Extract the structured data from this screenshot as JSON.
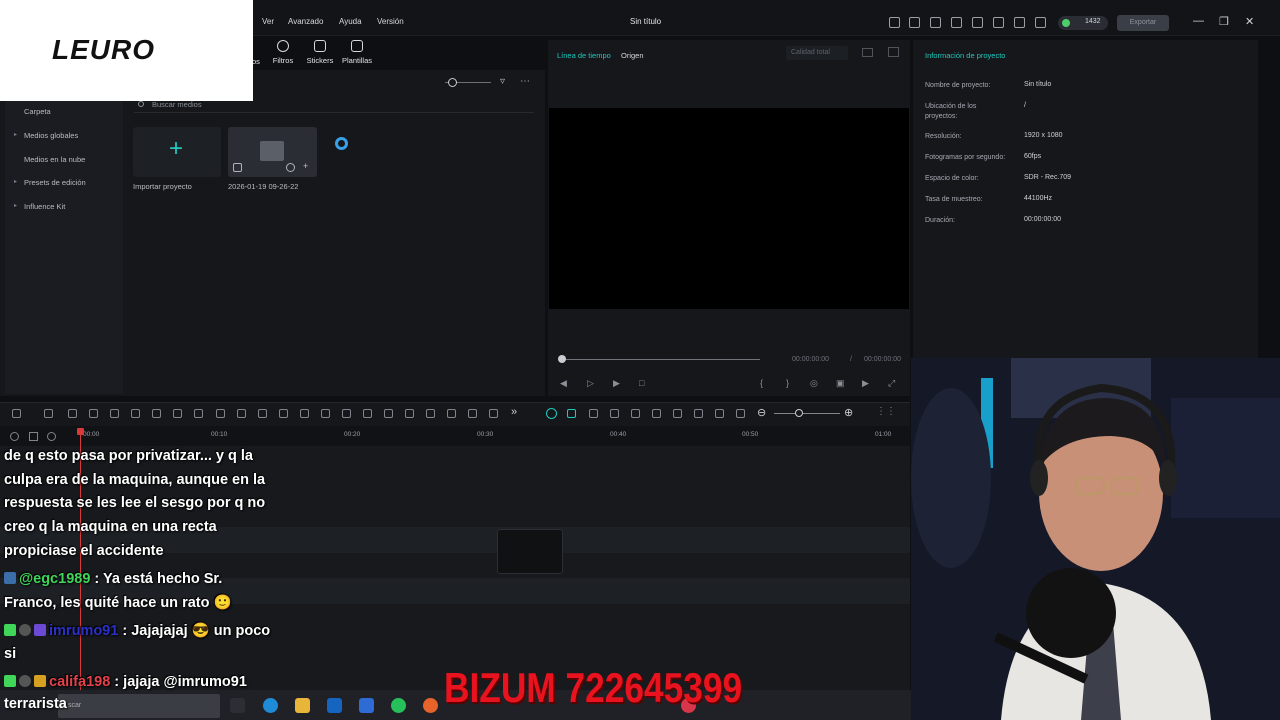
{
  "app": {
    "window_title": "Sin título",
    "menu": [
      "Ver",
      "Avanzado",
      "Ayuda",
      "Versión"
    ],
    "credits": "1432",
    "export_label": "Exportar"
  },
  "logo": {
    "text": "LEURO"
  },
  "media_tabs": [
    {
      "label": "Filtros",
      "icon": "filter-icon"
    },
    {
      "label": "Stickers",
      "icon": "sticker-icon"
    },
    {
      "label": "Plantillas",
      "icon": "template-icon"
    }
  ],
  "media_tab_partial": "os",
  "sidebar": {
    "items": [
      {
        "label": "Carpeta",
        "arrow": false
      },
      {
        "label": "Medios globales",
        "arrow": true
      },
      {
        "label": "Medios en la nube",
        "arrow": false
      },
      {
        "label": "Presets de edición",
        "arrow": true
      },
      {
        "label": "Influence Kit",
        "arrow": true
      }
    ]
  },
  "media": {
    "search_placeholder": "Buscar medios",
    "import_label": "Importar proyecto",
    "clip_label": "2026-01-19 09-26-22"
  },
  "preview": {
    "tab_timeline": "Línea de tiempo",
    "tab_source": "Origen",
    "quality": "Calidad total",
    "time_current": "00:00:00:00",
    "time_separator": "/",
    "time_total": "00:00:00:00"
  },
  "project_info": {
    "title": "Información de proyecto",
    "rows": [
      {
        "label": "Nombre de proyecto:",
        "value": "Sin título"
      },
      {
        "label": "Ubicación de los proyectos:",
        "value": "/"
      },
      {
        "label": "Resolución:",
        "value": "1920 x 1080"
      },
      {
        "label": "Fotogramas por segundo:",
        "value": "60fps"
      },
      {
        "label": "Espacio de color:",
        "value": "SDR - Rec.709"
      },
      {
        "label": "Tasa de muestreo:",
        "value": "44100Hz"
      },
      {
        "label": "Duración:",
        "value": "00:00:00:00"
      }
    ]
  },
  "timeline": {
    "ruler": [
      "00:00",
      "00:10",
      "00:20",
      "00:30",
      "00:40",
      "00:50",
      "01:00"
    ]
  },
  "chat": {
    "messages": [
      {
        "user": "",
        "text": "de q esto pasa por privatizar... y q la"
      },
      {
        "user": "",
        "text": "culpa era de la maquina, aunque en la"
      },
      {
        "user": "",
        "text": "respuesta se les lee el sesgo por q no"
      },
      {
        "user": "",
        "text": "creo q la maquina en una recta"
      },
      {
        "user": "",
        "text": "propiciase el accidente"
      },
      {
        "user": "@egc1989",
        "text": " : Ya está hecho Sr."
      },
      {
        "user": "",
        "text": "Franco, les quité hace un rato 🙂"
      },
      {
        "user": "imrumo91",
        "text": " : Jajajajaj 😎 un poco"
      },
      {
        "user": "",
        "text": "si"
      },
      {
        "user": "califa198",
        "text": " : jajaja @imrumo91"
      }
    ],
    "last_line": "terrarista"
  },
  "taskbar": {
    "search_partial": "scar"
  },
  "overlay": {
    "bizum": "BIZUM 722645399"
  },
  "colors": {
    "accent": "#22c8bd",
    "bizum": "#e8131e",
    "playhead": "#d83a3a"
  }
}
